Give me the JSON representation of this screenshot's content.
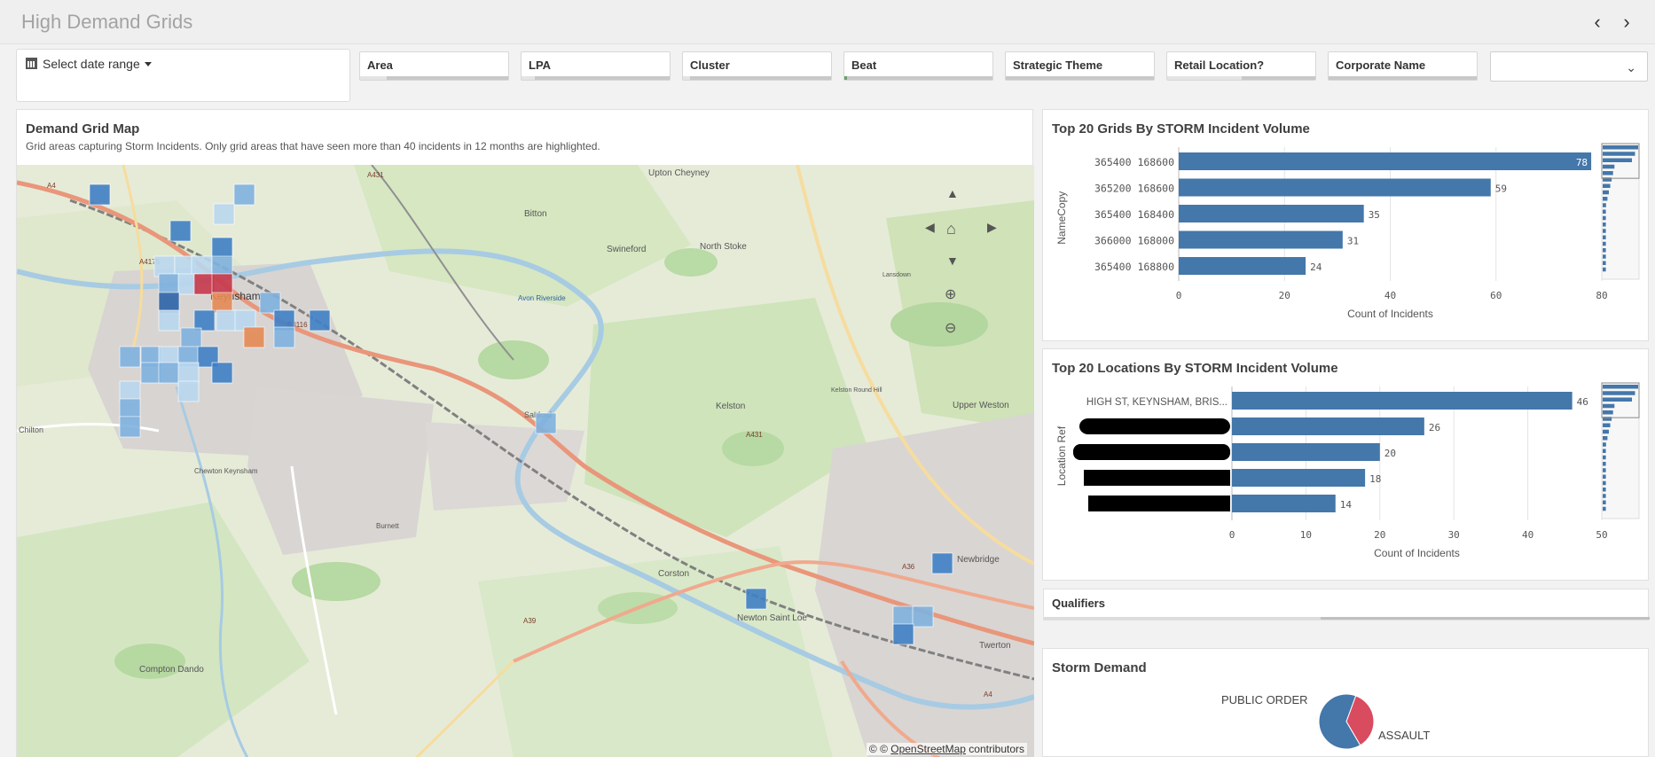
{
  "app": {
    "title": "High Demand Grids"
  },
  "nav": {
    "prev": "‹",
    "next": "›"
  },
  "filters": {
    "date_range_label": "Select date range",
    "panes": [
      "Area",
      "LPA",
      "Cluster",
      "Beat",
      "Strategic Theme",
      "Retail Location?",
      "Corporate Name"
    ],
    "dropdown_value": ""
  },
  "map_panel": {
    "title": "Demand Grid Map",
    "subtitle": "Grid areas capturing Storm Incidents. Only grid areas that have seen more than 40 incidents in 12 months are highlighted.",
    "attribution_prefix": "© © ",
    "attribution_link": "OpenStreetMap",
    "attribution_suffix": " contributors",
    "place_labels": [
      "Keynsham",
      "Upton Cheyney",
      "Bitton",
      "Swineford",
      "North Stoke",
      "Avon Riverside",
      "Saltford",
      "Kelston",
      "Upper Weston",
      "Chewton Keynsham",
      "Corston",
      "Newton Saint Loe",
      "Burnett",
      "Compton Dando",
      "Newbridge",
      "Twerton",
      "Chilton",
      "Lansdown",
      "Kelston Round Hill"
    ],
    "road_labels": [
      "A4",
      "A431",
      "A4175",
      "B3116",
      "A431",
      "A36",
      "A39",
      "A4"
    ],
    "colors": {
      "light": "#b9d7ee",
      "mid": "#7fb1de",
      "dark": "#3f7fc4",
      "darker": "#2e64a8",
      "hot": "#c6374a",
      "orange": "#e68a55"
    }
  },
  "grids_chart": {
    "title": "Top 20 Grids By STORM Incident Volume",
    "chart_data": {
      "type": "bar",
      "orientation": "horizontal",
      "title": "Top 20 Grids By STORM Incident Volume",
      "categories": [
        "365400 168600",
        "365200 168600",
        "365400 168400",
        "366000 168000",
        "365400 168800"
      ],
      "values": [
        78,
        59,
        35,
        31,
        24
      ],
      "xlabel": "Count of Incidents",
      "ylabel": "NameCopy",
      "xlim": [
        0,
        80
      ],
      "ticks": [
        0,
        20,
        40,
        60,
        80
      ],
      "bar_color": "#4477aa"
    }
  },
  "locations_chart": {
    "title": "Top 20 Locations By STORM Incident Volume",
    "chart_data": {
      "type": "bar",
      "orientation": "horizontal",
      "title": "Top 20 Locations By STORM Incident Volume",
      "categories": [
        "HIGH ST, KEYNSHAM, BRIS...",
        "",
        "",
        "",
        ""
      ],
      "values": [
        46,
        26,
        20,
        18,
        14
      ],
      "xlabel": "Count of Incidents",
      "ylabel": "Location Ref",
      "xlim": [
        0,
        50
      ],
      "ticks": [
        0,
        10,
        20,
        30,
        40,
        50
      ],
      "bar_color": "#4477aa"
    }
  },
  "qualifiers": {
    "title": "Qualifiers"
  },
  "storm_demand": {
    "title": "Storm Demand",
    "chart_data": {
      "type": "pie",
      "title": "Storm Demand",
      "labels": [
        "PUBLIC ORDER",
        "ASSAULT"
      ],
      "values": [
        36,
        64
      ],
      "colors": [
        "#d94b5f",
        "#4477aa"
      ]
    }
  }
}
